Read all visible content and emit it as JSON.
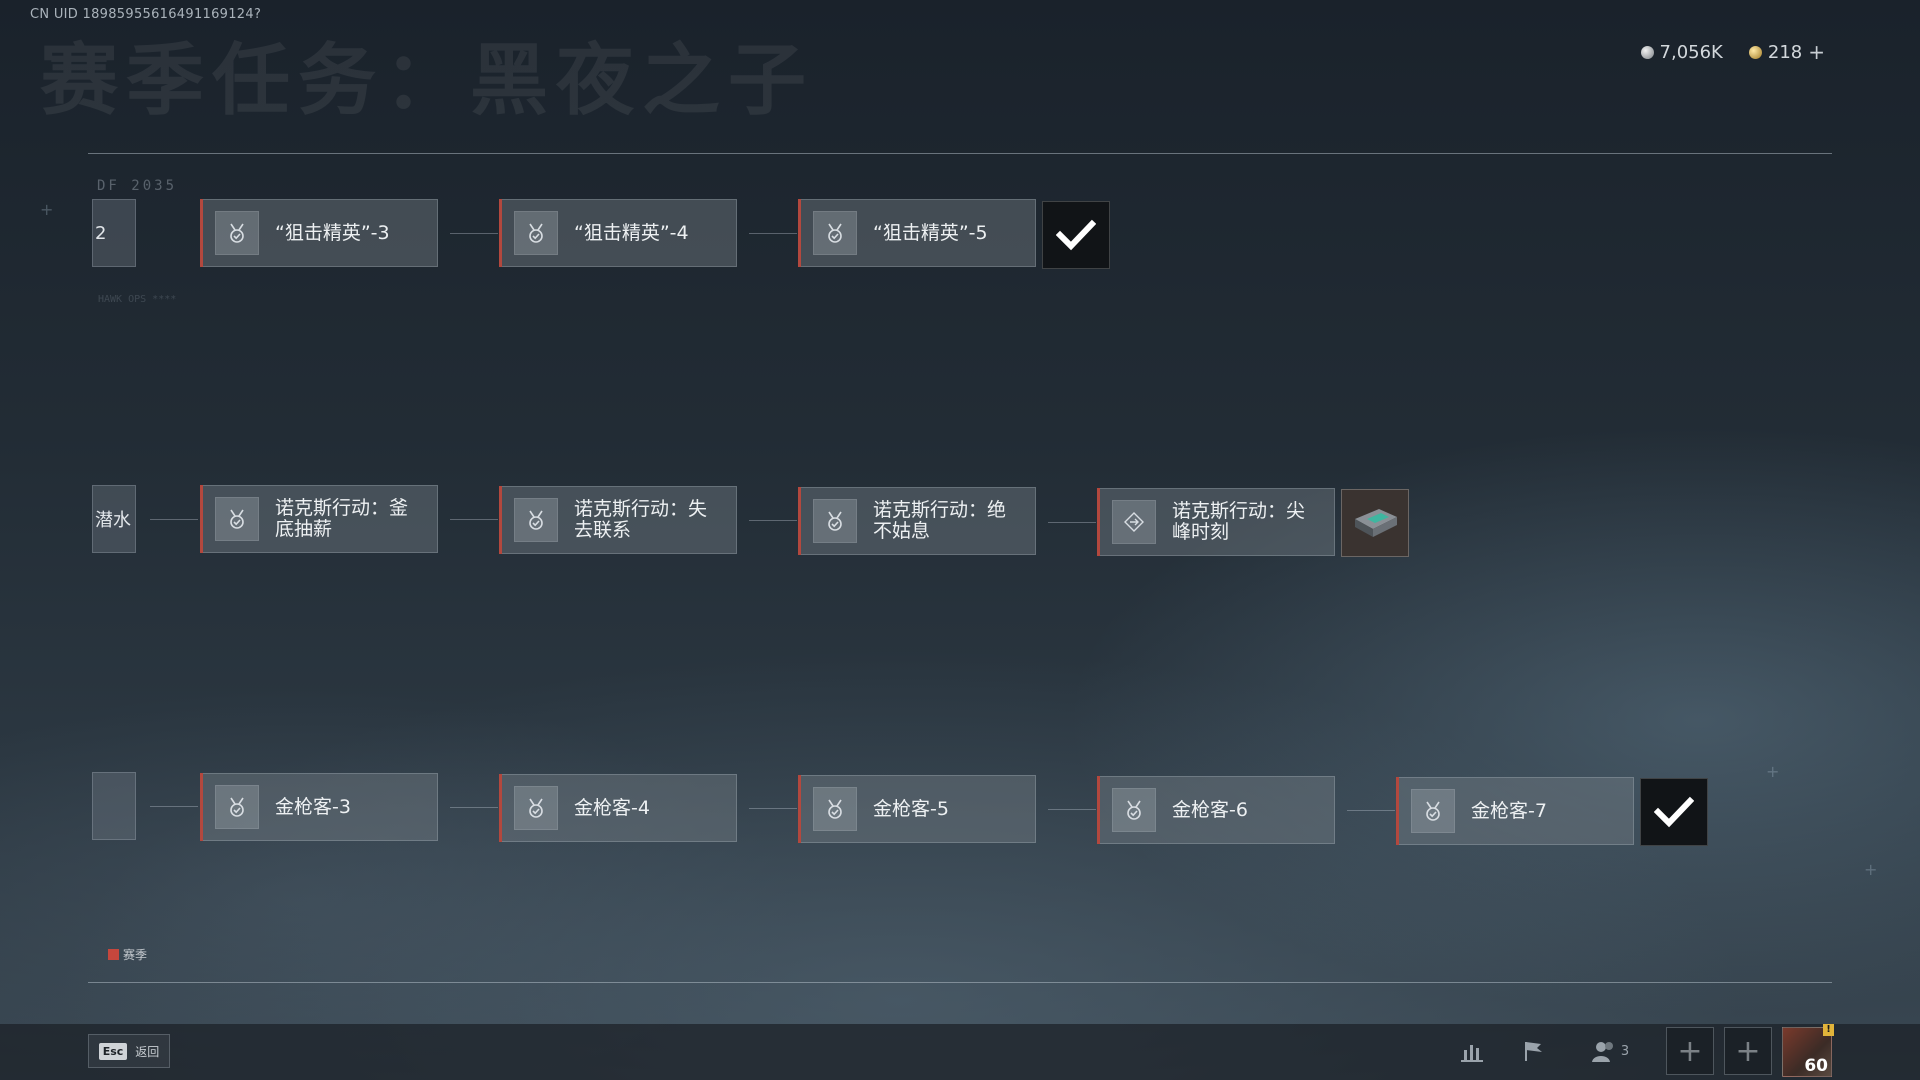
{
  "header": {
    "uid": "CN UID 18985955616491169124?",
    "title_ghost": "赛季任务：黑夜之子",
    "currency": [
      {
        "icon": "silver-coin-icon",
        "value": "7,056K"
      },
      {
        "icon": "gold-coin-icon",
        "value": "218"
      }
    ],
    "add_currency": "+"
  },
  "decor": {
    "df_label": "DF 2035",
    "hawk": "HAWK OPS ****"
  },
  "rows": [
    {
      "stub": "2",
      "cards": [
        {
          "label": "“狙击精英”-3",
          "icon": "medal-check-icon"
        },
        {
          "label": "“狙击精英”-4",
          "icon": "medal-check-icon"
        },
        {
          "label": "“狙击精英”-5",
          "icon": "medal-check-icon"
        }
      ],
      "reward": "checkmark"
    },
    {
      "stub": "潜水",
      "cards": [
        {
          "label": "诺克斯行动：釜底抽薪",
          "icon": "medal-check-icon"
        },
        {
          "label": "诺克斯行动：失去联系",
          "icon": "medal-check-icon"
        },
        {
          "label": "诺克斯行动：绝不姑息",
          "icon": "medal-check-icon"
        },
        {
          "label": "诺克斯行动：尖峰时刻",
          "icon": "diamond-arrows-icon"
        }
      ],
      "reward": "item-case"
    },
    {
      "stub": "",
      "cards": [
        {
          "label": "金枪客-3",
          "icon": "medal-check-icon"
        },
        {
          "label": "金枪客-4",
          "icon": "medal-check-icon"
        },
        {
          "label": "金枪客-5",
          "icon": "medal-check-icon"
        },
        {
          "label": "金枪客-6",
          "icon": "medal-check-icon"
        },
        {
          "label": "金枪客-7",
          "icon": "medal-check-icon"
        }
      ],
      "reward": "checkmark"
    }
  ],
  "legend": {
    "label": "赛季",
    "color": "#c5473d"
  },
  "footer": {
    "esc_key": "Esc",
    "back_label": "返回",
    "squad_count": "3",
    "level": "60",
    "alert": "!"
  }
}
